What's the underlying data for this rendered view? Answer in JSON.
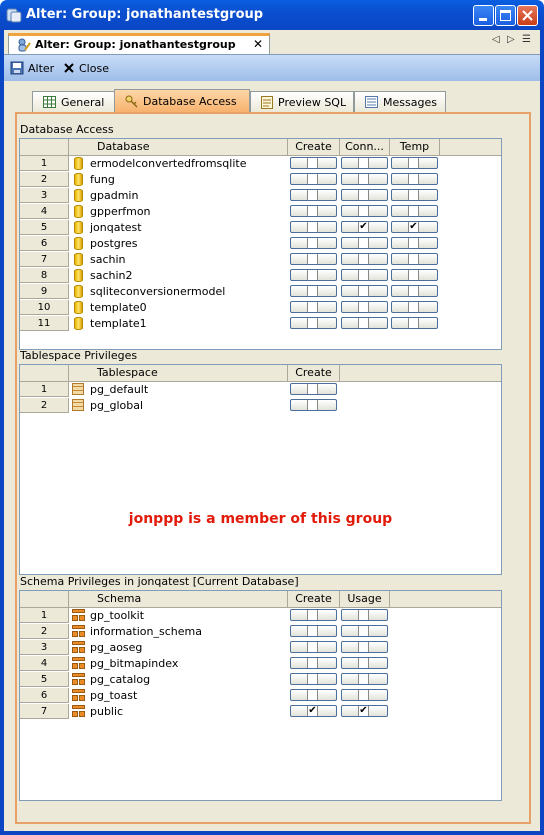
{
  "window": {
    "title": "Alter: Group: jonathantestgroup",
    "buttons": [
      "minimize",
      "maximize",
      "close"
    ]
  },
  "editor_tab": {
    "label": "Alter: Group: jonathantestgroup",
    "close_glyph": "✕"
  },
  "toolbar": {
    "alter_label": "Alter",
    "close_label": "Close"
  },
  "tabs": [
    {
      "label": "General",
      "icon": "table-icon"
    },
    {
      "label": "Database Access",
      "icon": "key-icon",
      "active": true
    },
    {
      "label": "Preview SQL",
      "icon": "sql-icon"
    },
    {
      "label": "Messages",
      "icon": "messages-icon"
    }
  ],
  "database_access": {
    "title": "Database Access",
    "columns": [
      "Database",
      "Create",
      "Conn...",
      "Temp"
    ],
    "rows": [
      {
        "num": "1",
        "name": "ermodelconvertedfromsqlite",
        "create": false,
        "conn": false,
        "temp": false
      },
      {
        "num": "2",
        "name": "fung",
        "create": false,
        "conn": false,
        "temp": false
      },
      {
        "num": "3",
        "name": "gpadmin",
        "create": false,
        "conn": false,
        "temp": false
      },
      {
        "num": "4",
        "name": "gpperfmon",
        "create": false,
        "conn": false,
        "temp": false
      },
      {
        "num": "5",
        "name": "jonqatest",
        "create": false,
        "conn": true,
        "temp": true
      },
      {
        "num": "6",
        "name": "postgres",
        "create": false,
        "conn": false,
        "temp": false
      },
      {
        "num": "7",
        "name": "sachin",
        "create": false,
        "conn": false,
        "temp": false
      },
      {
        "num": "8",
        "name": "sachin2",
        "create": false,
        "conn": false,
        "temp": false
      },
      {
        "num": "9",
        "name": "sqliteconversionermodel",
        "create": false,
        "conn": false,
        "temp": false
      },
      {
        "num": "10",
        "name": "template0",
        "create": false,
        "conn": false,
        "temp": false
      },
      {
        "num": "11",
        "name": "template1",
        "create": false,
        "conn": false,
        "temp": false
      }
    ]
  },
  "tablespace_privileges": {
    "title": "Tablespace Privileges",
    "columns": [
      "Tablespace",
      "Create"
    ],
    "rows": [
      {
        "num": "1",
        "name": "pg_default",
        "create": false
      },
      {
        "num": "2",
        "name": "pg_global",
        "create": false
      }
    ],
    "member_message": "jonppp is a member of this group"
  },
  "schema_privileges": {
    "title": "Schema Privileges in jonqatest [Current Database]",
    "columns": [
      "Schema",
      "Create",
      "Usage"
    ],
    "rows": [
      {
        "num": "1",
        "name": "gp_toolkit",
        "create": false,
        "usage": false
      },
      {
        "num": "2",
        "name": "information_schema",
        "create": false,
        "usage": false
      },
      {
        "num": "3",
        "name": "pg_aoseg",
        "create": false,
        "usage": false
      },
      {
        "num": "4",
        "name": "pg_bitmapindex",
        "create": false,
        "usage": false
      },
      {
        "num": "5",
        "name": "pg_catalog",
        "create": false,
        "usage": false
      },
      {
        "num": "6",
        "name": "pg_toast",
        "create": false,
        "usage": false
      },
      {
        "num": "7",
        "name": "public",
        "create": true,
        "usage": true
      }
    ]
  },
  "colors": {
    "titlebar": "#0a4fd0",
    "active_tab": "#f7b16b",
    "panel_border": "#e8a069",
    "member_text": "#e21a0a"
  }
}
